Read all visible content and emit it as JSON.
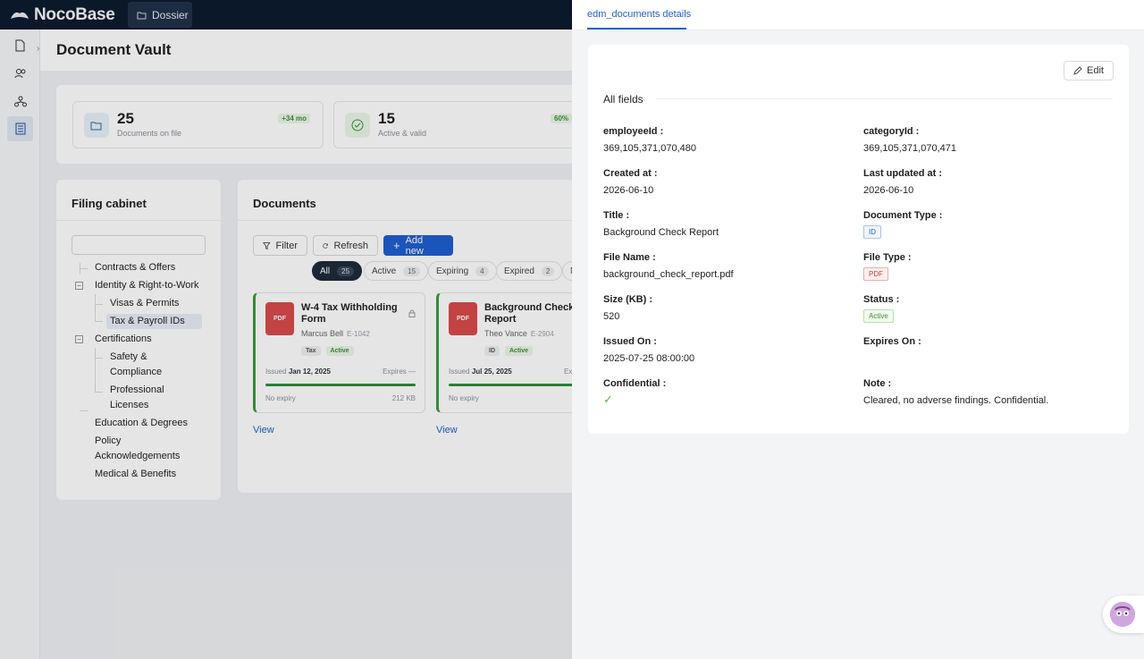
{
  "app": {
    "logo_text": "NocoBase",
    "top_menu": {
      "dossier_label": "Dossier"
    }
  },
  "page": {
    "title": "Document Vault"
  },
  "stats": [
    {
      "value": "25",
      "label": "Documents on file",
      "delta": "+34 mo"
    },
    {
      "value": "15",
      "label": "Active & valid",
      "delta": "60%"
    }
  ],
  "cabinet": {
    "title": "Filing cabinet",
    "items": [
      {
        "label": "Contracts & Offers"
      },
      {
        "label": "Identity & Right-to-Work"
      },
      {
        "label": "Visas & Permits"
      },
      {
        "label": "Tax & Payroll IDs"
      },
      {
        "label": "Certifications"
      },
      {
        "label": "Safety &"
      },
      {
        "label": "Compliance"
      },
      {
        "label": "Professional"
      },
      {
        "label": "Licenses"
      },
      {
        "label": "Education & Degrees"
      },
      {
        "label": "Policy"
      },
      {
        "label": "Acknowledgements"
      },
      {
        "label": "Medical & Benefits"
      }
    ]
  },
  "documents": {
    "title": "Documents",
    "filter_label": "Filter",
    "refresh_label": "Refresh",
    "add_label": "Add new",
    "pills": [
      {
        "label": "All",
        "count": "25"
      },
      {
        "label": "Active",
        "count": "15"
      },
      {
        "label": "Expiring",
        "count": "4"
      },
      {
        "label": "Expired",
        "count": "2"
      },
      {
        "label": "N"
      }
    ],
    "cards": [
      {
        "badge": "PDF",
        "title": "W-4 Tax Withholding Form",
        "person": "Marcus Bell",
        "emp": "E-1042",
        "tag": "Tax",
        "status": "Active",
        "issued_label": "Issued",
        "issued": "Jan 12, 2025",
        "expires": "Expires —",
        "expiry": "No expiry",
        "size": "212 KB",
        "view": "View"
      },
      {
        "badge": "PDF",
        "title": "Background Check Report",
        "person": "Theo Vance",
        "emp": "E-2904",
        "tag": "ID",
        "status": "Active",
        "issued_label": "Issued",
        "issued": "Jul 25, 2025",
        "expires": "Ex",
        "expiry": "No expiry",
        "size": "",
        "view": "View"
      }
    ]
  },
  "drawer": {
    "tab": "edm_documents details",
    "edit_label": "Edit",
    "section": "All fields",
    "fields": {
      "employee_label": "employeeId :",
      "employee": "369,105,371,070,480",
      "category_label": "categoryId :",
      "category": "369,105,371,070,471",
      "created_label": "Created at :",
      "created": "2026-06-10",
      "updated_label": "Last updated at :",
      "updated": "2026-06-10",
      "title_label": "Title :",
      "title": "Background Check Report",
      "doctype_label": "Document Type :",
      "doctype": "ID",
      "filename_label": "File Name :",
      "filename": "background_check_report.pdf",
      "filetype_label": "File Type :",
      "filetype": "PDF",
      "size_label": "Size (KB) :",
      "size": "520",
      "status_label": "Status :",
      "status": "Active",
      "issued_label": "Issued On :",
      "issued": "2025-07-25 08:00:00",
      "expires_label": "Expires On :",
      "confidential_label": "Confidential :",
      "note_label": "Note :",
      "note": "Cleared, no adverse findings. Confidential."
    }
  },
  "colors": {
    "primary": "#1f5fd1",
    "topbar": "#0d1b2e",
    "success": "#3f8f37",
    "pdf": "#d94b4b"
  }
}
